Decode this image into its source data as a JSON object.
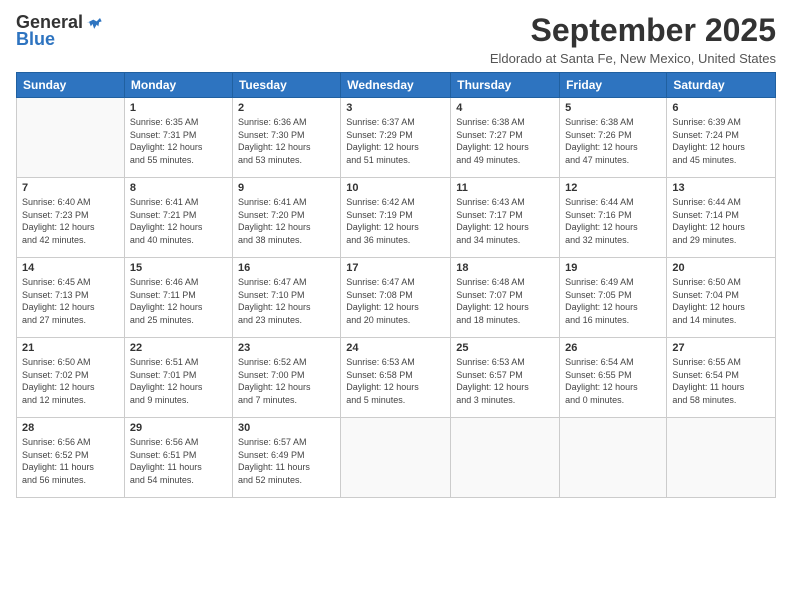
{
  "logo": {
    "general": "General",
    "blue": "Blue"
  },
  "header": {
    "title": "September 2025",
    "location": "Eldorado at Santa Fe, New Mexico, United States"
  },
  "weekdays": [
    "Sunday",
    "Monday",
    "Tuesday",
    "Wednesday",
    "Thursday",
    "Friday",
    "Saturday"
  ],
  "weeks": [
    [
      {
        "day": "",
        "info": ""
      },
      {
        "day": "1",
        "info": "Sunrise: 6:35 AM\nSunset: 7:31 PM\nDaylight: 12 hours\nand 55 minutes."
      },
      {
        "day": "2",
        "info": "Sunrise: 6:36 AM\nSunset: 7:30 PM\nDaylight: 12 hours\nand 53 minutes."
      },
      {
        "day": "3",
        "info": "Sunrise: 6:37 AM\nSunset: 7:29 PM\nDaylight: 12 hours\nand 51 minutes."
      },
      {
        "day": "4",
        "info": "Sunrise: 6:38 AM\nSunset: 7:27 PM\nDaylight: 12 hours\nand 49 minutes."
      },
      {
        "day": "5",
        "info": "Sunrise: 6:38 AM\nSunset: 7:26 PM\nDaylight: 12 hours\nand 47 minutes."
      },
      {
        "day": "6",
        "info": "Sunrise: 6:39 AM\nSunset: 7:24 PM\nDaylight: 12 hours\nand 45 minutes."
      }
    ],
    [
      {
        "day": "7",
        "info": "Sunrise: 6:40 AM\nSunset: 7:23 PM\nDaylight: 12 hours\nand 42 minutes."
      },
      {
        "day": "8",
        "info": "Sunrise: 6:41 AM\nSunset: 7:21 PM\nDaylight: 12 hours\nand 40 minutes."
      },
      {
        "day": "9",
        "info": "Sunrise: 6:41 AM\nSunset: 7:20 PM\nDaylight: 12 hours\nand 38 minutes."
      },
      {
        "day": "10",
        "info": "Sunrise: 6:42 AM\nSunset: 7:19 PM\nDaylight: 12 hours\nand 36 minutes."
      },
      {
        "day": "11",
        "info": "Sunrise: 6:43 AM\nSunset: 7:17 PM\nDaylight: 12 hours\nand 34 minutes."
      },
      {
        "day": "12",
        "info": "Sunrise: 6:44 AM\nSunset: 7:16 PM\nDaylight: 12 hours\nand 32 minutes."
      },
      {
        "day": "13",
        "info": "Sunrise: 6:44 AM\nSunset: 7:14 PM\nDaylight: 12 hours\nand 29 minutes."
      }
    ],
    [
      {
        "day": "14",
        "info": "Sunrise: 6:45 AM\nSunset: 7:13 PM\nDaylight: 12 hours\nand 27 minutes."
      },
      {
        "day": "15",
        "info": "Sunrise: 6:46 AM\nSunset: 7:11 PM\nDaylight: 12 hours\nand 25 minutes."
      },
      {
        "day": "16",
        "info": "Sunrise: 6:47 AM\nSunset: 7:10 PM\nDaylight: 12 hours\nand 23 minutes."
      },
      {
        "day": "17",
        "info": "Sunrise: 6:47 AM\nSunset: 7:08 PM\nDaylight: 12 hours\nand 20 minutes."
      },
      {
        "day": "18",
        "info": "Sunrise: 6:48 AM\nSunset: 7:07 PM\nDaylight: 12 hours\nand 18 minutes."
      },
      {
        "day": "19",
        "info": "Sunrise: 6:49 AM\nSunset: 7:05 PM\nDaylight: 12 hours\nand 16 minutes."
      },
      {
        "day": "20",
        "info": "Sunrise: 6:50 AM\nSunset: 7:04 PM\nDaylight: 12 hours\nand 14 minutes."
      }
    ],
    [
      {
        "day": "21",
        "info": "Sunrise: 6:50 AM\nSunset: 7:02 PM\nDaylight: 12 hours\nand 12 minutes."
      },
      {
        "day": "22",
        "info": "Sunrise: 6:51 AM\nSunset: 7:01 PM\nDaylight: 12 hours\nand 9 minutes."
      },
      {
        "day": "23",
        "info": "Sunrise: 6:52 AM\nSunset: 7:00 PM\nDaylight: 12 hours\nand 7 minutes."
      },
      {
        "day": "24",
        "info": "Sunrise: 6:53 AM\nSunset: 6:58 PM\nDaylight: 12 hours\nand 5 minutes."
      },
      {
        "day": "25",
        "info": "Sunrise: 6:53 AM\nSunset: 6:57 PM\nDaylight: 12 hours\nand 3 minutes."
      },
      {
        "day": "26",
        "info": "Sunrise: 6:54 AM\nSunset: 6:55 PM\nDaylight: 12 hours\nand 0 minutes."
      },
      {
        "day": "27",
        "info": "Sunrise: 6:55 AM\nSunset: 6:54 PM\nDaylight: 11 hours\nand 58 minutes."
      }
    ],
    [
      {
        "day": "28",
        "info": "Sunrise: 6:56 AM\nSunset: 6:52 PM\nDaylight: 11 hours\nand 56 minutes."
      },
      {
        "day": "29",
        "info": "Sunrise: 6:56 AM\nSunset: 6:51 PM\nDaylight: 11 hours\nand 54 minutes."
      },
      {
        "day": "30",
        "info": "Sunrise: 6:57 AM\nSunset: 6:49 PM\nDaylight: 11 hours\nand 52 minutes."
      },
      {
        "day": "",
        "info": ""
      },
      {
        "day": "",
        "info": ""
      },
      {
        "day": "",
        "info": ""
      },
      {
        "day": "",
        "info": ""
      }
    ]
  ]
}
